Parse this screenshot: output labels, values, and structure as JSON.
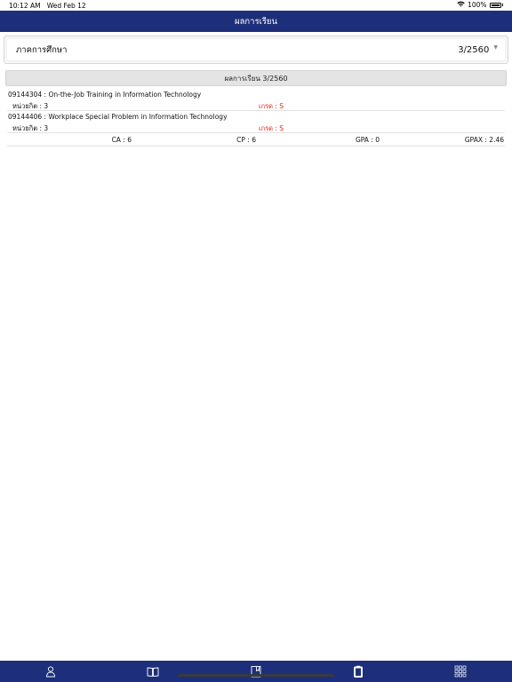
{
  "status_bar": {
    "time": "10:12 AM",
    "date": "Wed Feb 12",
    "battery": "100%"
  },
  "nav": {
    "title": "ผลการเรียน"
  },
  "semester": {
    "label": "ภาคการศึกษา",
    "value": "3/2560"
  },
  "section": {
    "header": "ผลการเรียน 3/2560"
  },
  "courses": [
    {
      "title": "09144304 : On-the-Job Training in Information Technology",
      "credit": "หน่วยกิต : 3",
      "grade": "เกรด : S"
    },
    {
      "title": "09144406 : Workplace Special Problem in Information Technology",
      "credit": "หน่วยกิต : 3",
      "grade": "เกรด : S"
    }
  ],
  "summary": {
    "ca": "CA : 6",
    "cp": "CP : 6",
    "gpa": "GPA : 0",
    "gpax": "GPAX : 2.46"
  },
  "tabs": [
    {
      "icon": "user-icon"
    },
    {
      "icon": "book-open-icon"
    },
    {
      "icon": "bookmark-book-icon"
    },
    {
      "icon": "clipboard-icon",
      "active": true
    },
    {
      "icon": "grid-menu-icon"
    }
  ],
  "colors": {
    "nav_bg": "#1d2f7b",
    "grade_red": "#e0221c",
    "header_bg": "#e4e4e4"
  }
}
